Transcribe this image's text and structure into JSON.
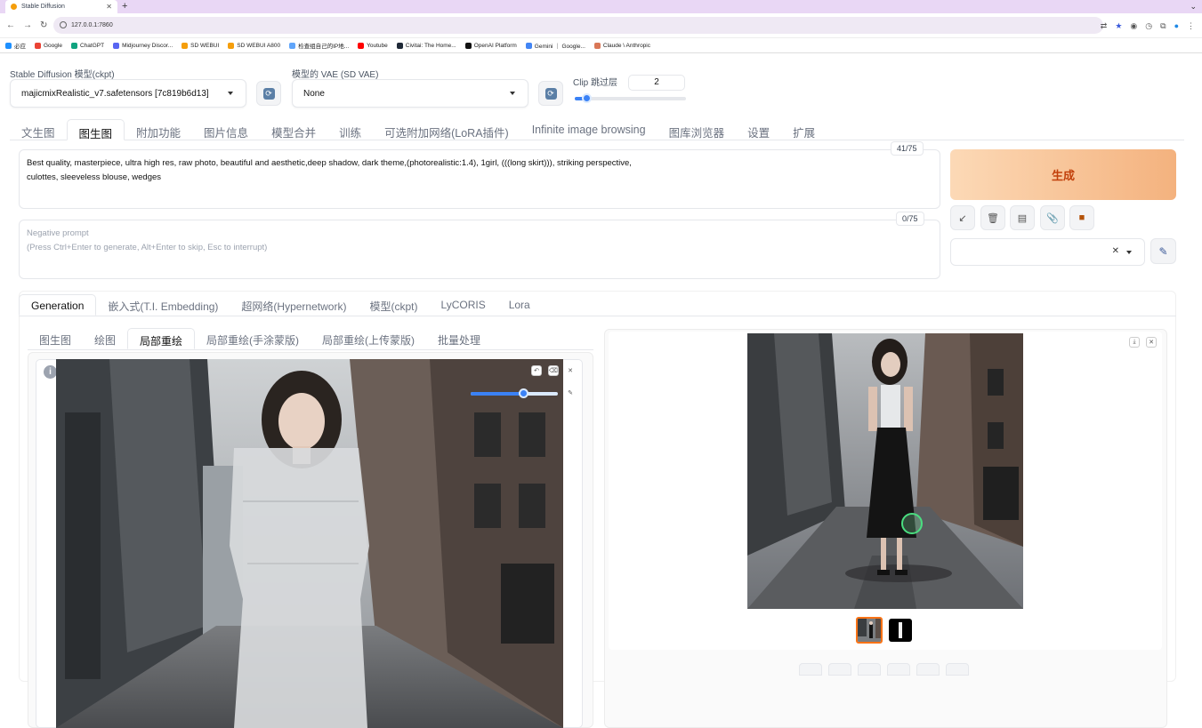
{
  "browser": {
    "tab_title": "Stable Diffusion",
    "url": "127.0.0.1:7860",
    "bookmarks": [
      "必应",
      "Google",
      "ChatGPT",
      "Midjourney Discor...",
      "SD WEBUI",
      "SD WEBUI A800",
      "检查组自己的IP地...",
      "Youtube",
      "Civitai: The Home...",
      "OpenAI Platform",
      "Gemini ｜ Google...",
      "Claude \\ Anthropic"
    ]
  },
  "settings": {
    "ckpt_label": "Stable Diffusion 模型(ckpt)",
    "ckpt_value": "majicmixRealistic_v7.safetensors [7c819b6d13]",
    "vae_label": "模型的 VAE (SD VAE)",
    "vae_value": "None",
    "clip_label": "Clip 跳过层",
    "clip_value": "2",
    "clip_fraction": 0.1
  },
  "main_tabs": [
    "文生图",
    "图生图",
    "附加功能",
    "图片信息",
    "模型合并",
    "训练",
    "可选附加网络(LoRA插件)",
    "Infinite image browsing",
    "图库浏览器",
    "设置",
    "扩展"
  ],
  "main_tab_active": "图生图",
  "prompt": {
    "text_line1": "Best quality, masterpiece, ultra high res, raw photo, beautiful and aesthetic,deep shadow, dark theme,(photorealistic:1.4), 1girl, (((long skirt))), striking perspective,",
    "text_line2": "culottes, sleeveless blouse, wedges",
    "counter": "41/75"
  },
  "negative_prompt": {
    "placeholder_line1": "Negative prompt",
    "placeholder_line2": "(Press Ctrl+Enter to generate, Alt+Enter to skip, Esc to interrupt)",
    "counter": "0/75"
  },
  "generate_label": "生成",
  "extra_tabs": [
    "Generation",
    "嵌入式(T.I. Embedding)",
    "超网络(Hypernetwork)",
    "模型(ckpt)",
    "LyCORIS",
    "Lora"
  ],
  "extra_tab_active": "Generation",
  "img2img_tabs": [
    "图生图",
    "绘图",
    "局部重绘",
    "局部重绘(手涂蒙版)",
    "局部重绘(上传蒙版)",
    "批量处理"
  ],
  "img2img_tab_active": "局部重绘",
  "brush_size_fraction": 0.6,
  "icons": {
    "tools": [
      "arrow-icon",
      "trash-icon",
      "clipboard-icon",
      "paperclip-icon",
      "box-icon"
    ]
  }
}
